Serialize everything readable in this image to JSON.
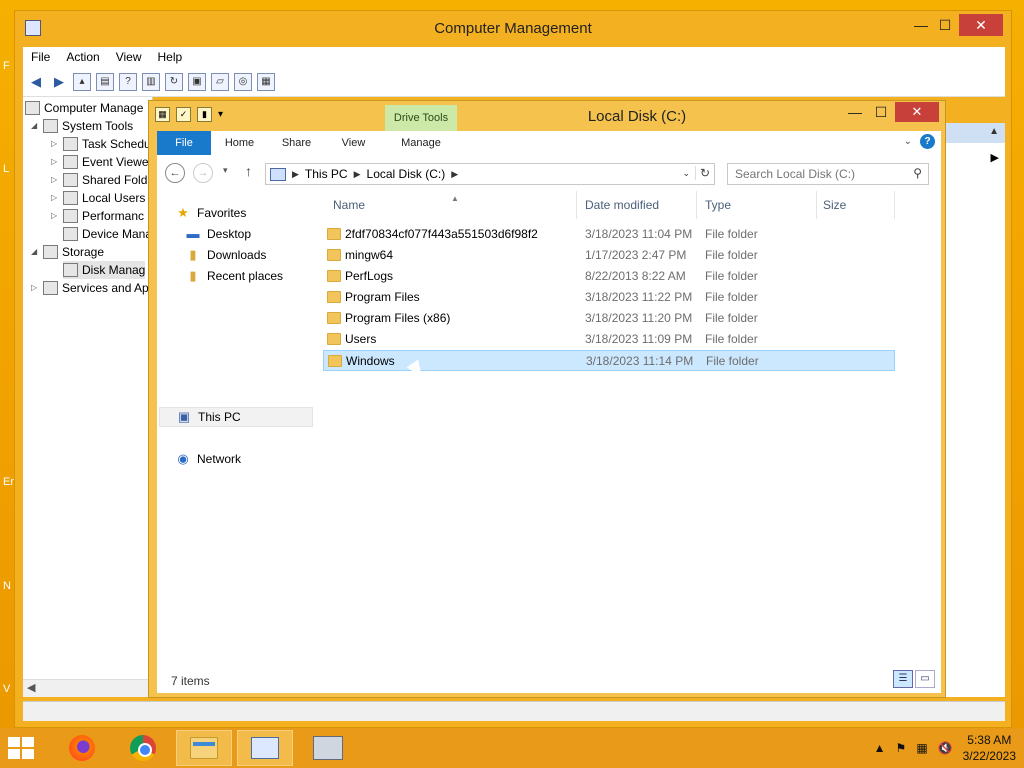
{
  "desktop": {
    "edge_letters": [
      "F",
      "L",
      "Er",
      "N",
      "V"
    ]
  },
  "cm": {
    "title": "Computer Management",
    "controls": {
      "minimize": "—",
      "maximize": "☐",
      "close": "✕"
    },
    "menu": [
      "File",
      "Action",
      "View",
      "Help"
    ],
    "tree": [
      {
        "label": "Computer Manage",
        "icon": "computer-icon"
      },
      {
        "label": "System Tools",
        "icon": "tools-icon"
      },
      {
        "label": "Task Schedu",
        "icon": "clock-icon"
      },
      {
        "label": "Event Viewe",
        "icon": "event-icon"
      },
      {
        "label": "Shared Fold",
        "icon": "shared-folder-icon"
      },
      {
        "label": "Local Users",
        "icon": "users-icon"
      },
      {
        "label": "Performanc",
        "icon": "performance-icon"
      },
      {
        "label": "Device Mana",
        "icon": "device-icon"
      },
      {
        "label": "Storage",
        "icon": "storage-icon"
      },
      {
        "label": "Disk Manag",
        "icon": "disk-icon"
      },
      {
        "label": "Services and Ap",
        "icon": "services-icon"
      }
    ]
  },
  "explorer": {
    "title": "Local Disk (C:)",
    "controls": {
      "minimize": "—",
      "maximize": "☐",
      "close": "✕"
    },
    "drive_tools": "Drive Tools",
    "tabs": {
      "file": "File",
      "home": "Home",
      "share": "Share",
      "view": "View",
      "manage": "Manage"
    },
    "help": "?",
    "breadcrumb": [
      "This PC",
      "Local Disk (C:)"
    ],
    "search_placeholder": "Search Local Disk (C:)",
    "nav": {
      "favorites": "Favorites",
      "desktop": "Desktop",
      "downloads": "Downloads",
      "recent": "Recent places",
      "thispc": "This PC",
      "network": "Network"
    },
    "columns": {
      "name": "Name",
      "date": "Date modified",
      "type": "Type",
      "size": "Size"
    },
    "files": [
      {
        "name": "2fdf70834cf077f443a551503d6f98f2",
        "date": "3/18/2023 11:04 PM",
        "type": "File folder"
      },
      {
        "name": "mingw64",
        "date": "1/17/2023 2:47 PM",
        "type": "File folder"
      },
      {
        "name": "PerfLogs",
        "date": "8/22/2013 8:22 AM",
        "type": "File folder"
      },
      {
        "name": "Program Files",
        "date": "3/18/2023 11:22 PM",
        "type": "File folder"
      },
      {
        "name": "Program Files (x86)",
        "date": "3/18/2023 11:20 PM",
        "type": "File folder"
      },
      {
        "name": "Users",
        "date": "3/18/2023 11:09 PM",
        "type": "File folder"
      },
      {
        "name": "Windows",
        "date": "3/18/2023 11:14 PM",
        "type": "File folder"
      }
    ],
    "status": "7 items"
  },
  "taskbar": {
    "apps": [
      "firefox-icon",
      "chrome-icon",
      "file-explorer-icon",
      "computer-management-icon",
      "network-icon"
    ],
    "clock_time": "5:38 AM",
    "clock_date": "3/22/2023"
  }
}
